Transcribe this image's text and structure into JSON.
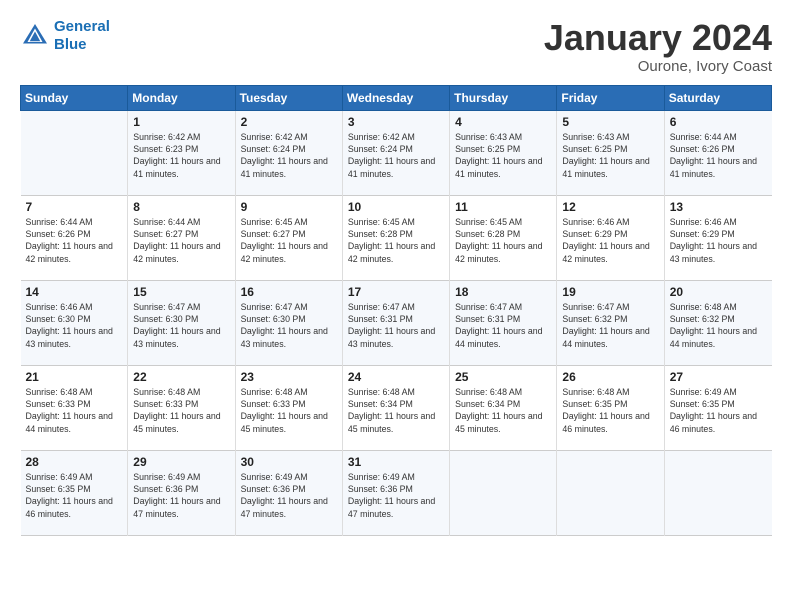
{
  "logo": {
    "line1": "General",
    "line2": "Blue"
  },
  "title": "January 2024",
  "location": "Ourone, Ivory Coast",
  "days_header": [
    "Sunday",
    "Monday",
    "Tuesday",
    "Wednesday",
    "Thursday",
    "Friday",
    "Saturday"
  ],
  "weeks": [
    [
      {
        "day": "",
        "sunrise": "",
        "sunset": "",
        "daylight": ""
      },
      {
        "day": "1",
        "sunrise": "Sunrise: 6:42 AM",
        "sunset": "Sunset: 6:23 PM",
        "daylight": "Daylight: 11 hours and 41 minutes."
      },
      {
        "day": "2",
        "sunrise": "Sunrise: 6:42 AM",
        "sunset": "Sunset: 6:24 PM",
        "daylight": "Daylight: 11 hours and 41 minutes."
      },
      {
        "day": "3",
        "sunrise": "Sunrise: 6:42 AM",
        "sunset": "Sunset: 6:24 PM",
        "daylight": "Daylight: 11 hours and 41 minutes."
      },
      {
        "day": "4",
        "sunrise": "Sunrise: 6:43 AM",
        "sunset": "Sunset: 6:25 PM",
        "daylight": "Daylight: 11 hours and 41 minutes."
      },
      {
        "day": "5",
        "sunrise": "Sunrise: 6:43 AM",
        "sunset": "Sunset: 6:25 PM",
        "daylight": "Daylight: 11 hours and 41 minutes."
      },
      {
        "day": "6",
        "sunrise": "Sunrise: 6:44 AM",
        "sunset": "Sunset: 6:26 PM",
        "daylight": "Daylight: 11 hours and 41 minutes."
      }
    ],
    [
      {
        "day": "7",
        "sunrise": "Sunrise: 6:44 AM",
        "sunset": "Sunset: 6:26 PM",
        "daylight": "Daylight: 11 hours and 42 minutes."
      },
      {
        "day": "8",
        "sunrise": "Sunrise: 6:44 AM",
        "sunset": "Sunset: 6:27 PM",
        "daylight": "Daylight: 11 hours and 42 minutes."
      },
      {
        "day": "9",
        "sunrise": "Sunrise: 6:45 AM",
        "sunset": "Sunset: 6:27 PM",
        "daylight": "Daylight: 11 hours and 42 minutes."
      },
      {
        "day": "10",
        "sunrise": "Sunrise: 6:45 AM",
        "sunset": "Sunset: 6:28 PM",
        "daylight": "Daylight: 11 hours and 42 minutes."
      },
      {
        "day": "11",
        "sunrise": "Sunrise: 6:45 AM",
        "sunset": "Sunset: 6:28 PM",
        "daylight": "Daylight: 11 hours and 42 minutes."
      },
      {
        "day": "12",
        "sunrise": "Sunrise: 6:46 AM",
        "sunset": "Sunset: 6:29 PM",
        "daylight": "Daylight: 11 hours and 42 minutes."
      },
      {
        "day": "13",
        "sunrise": "Sunrise: 6:46 AM",
        "sunset": "Sunset: 6:29 PM",
        "daylight": "Daylight: 11 hours and 43 minutes."
      }
    ],
    [
      {
        "day": "14",
        "sunrise": "Sunrise: 6:46 AM",
        "sunset": "Sunset: 6:30 PM",
        "daylight": "Daylight: 11 hours and 43 minutes."
      },
      {
        "day": "15",
        "sunrise": "Sunrise: 6:47 AM",
        "sunset": "Sunset: 6:30 PM",
        "daylight": "Daylight: 11 hours and 43 minutes."
      },
      {
        "day": "16",
        "sunrise": "Sunrise: 6:47 AM",
        "sunset": "Sunset: 6:30 PM",
        "daylight": "Daylight: 11 hours and 43 minutes."
      },
      {
        "day": "17",
        "sunrise": "Sunrise: 6:47 AM",
        "sunset": "Sunset: 6:31 PM",
        "daylight": "Daylight: 11 hours and 43 minutes."
      },
      {
        "day": "18",
        "sunrise": "Sunrise: 6:47 AM",
        "sunset": "Sunset: 6:31 PM",
        "daylight": "Daylight: 11 hours and 44 minutes."
      },
      {
        "day": "19",
        "sunrise": "Sunrise: 6:47 AM",
        "sunset": "Sunset: 6:32 PM",
        "daylight": "Daylight: 11 hours and 44 minutes."
      },
      {
        "day": "20",
        "sunrise": "Sunrise: 6:48 AM",
        "sunset": "Sunset: 6:32 PM",
        "daylight": "Daylight: 11 hours and 44 minutes."
      }
    ],
    [
      {
        "day": "21",
        "sunrise": "Sunrise: 6:48 AM",
        "sunset": "Sunset: 6:33 PM",
        "daylight": "Daylight: 11 hours and 44 minutes."
      },
      {
        "day": "22",
        "sunrise": "Sunrise: 6:48 AM",
        "sunset": "Sunset: 6:33 PM",
        "daylight": "Daylight: 11 hours and 45 minutes."
      },
      {
        "day": "23",
        "sunrise": "Sunrise: 6:48 AM",
        "sunset": "Sunset: 6:33 PM",
        "daylight": "Daylight: 11 hours and 45 minutes."
      },
      {
        "day": "24",
        "sunrise": "Sunrise: 6:48 AM",
        "sunset": "Sunset: 6:34 PM",
        "daylight": "Daylight: 11 hours and 45 minutes."
      },
      {
        "day": "25",
        "sunrise": "Sunrise: 6:48 AM",
        "sunset": "Sunset: 6:34 PM",
        "daylight": "Daylight: 11 hours and 45 minutes."
      },
      {
        "day": "26",
        "sunrise": "Sunrise: 6:48 AM",
        "sunset": "Sunset: 6:35 PM",
        "daylight": "Daylight: 11 hours and 46 minutes."
      },
      {
        "day": "27",
        "sunrise": "Sunrise: 6:49 AM",
        "sunset": "Sunset: 6:35 PM",
        "daylight": "Daylight: 11 hours and 46 minutes."
      }
    ],
    [
      {
        "day": "28",
        "sunrise": "Sunrise: 6:49 AM",
        "sunset": "Sunset: 6:35 PM",
        "daylight": "Daylight: 11 hours and 46 minutes."
      },
      {
        "day": "29",
        "sunrise": "Sunrise: 6:49 AM",
        "sunset": "Sunset: 6:36 PM",
        "daylight": "Daylight: 11 hours and 47 minutes."
      },
      {
        "day": "30",
        "sunrise": "Sunrise: 6:49 AM",
        "sunset": "Sunset: 6:36 PM",
        "daylight": "Daylight: 11 hours and 47 minutes."
      },
      {
        "day": "31",
        "sunrise": "Sunrise: 6:49 AM",
        "sunset": "Sunset: 6:36 PM",
        "daylight": "Daylight: 11 hours and 47 minutes."
      },
      {
        "day": "",
        "sunrise": "",
        "sunset": "",
        "daylight": ""
      },
      {
        "day": "",
        "sunrise": "",
        "sunset": "",
        "daylight": ""
      },
      {
        "day": "",
        "sunrise": "",
        "sunset": "",
        "daylight": ""
      }
    ]
  ]
}
